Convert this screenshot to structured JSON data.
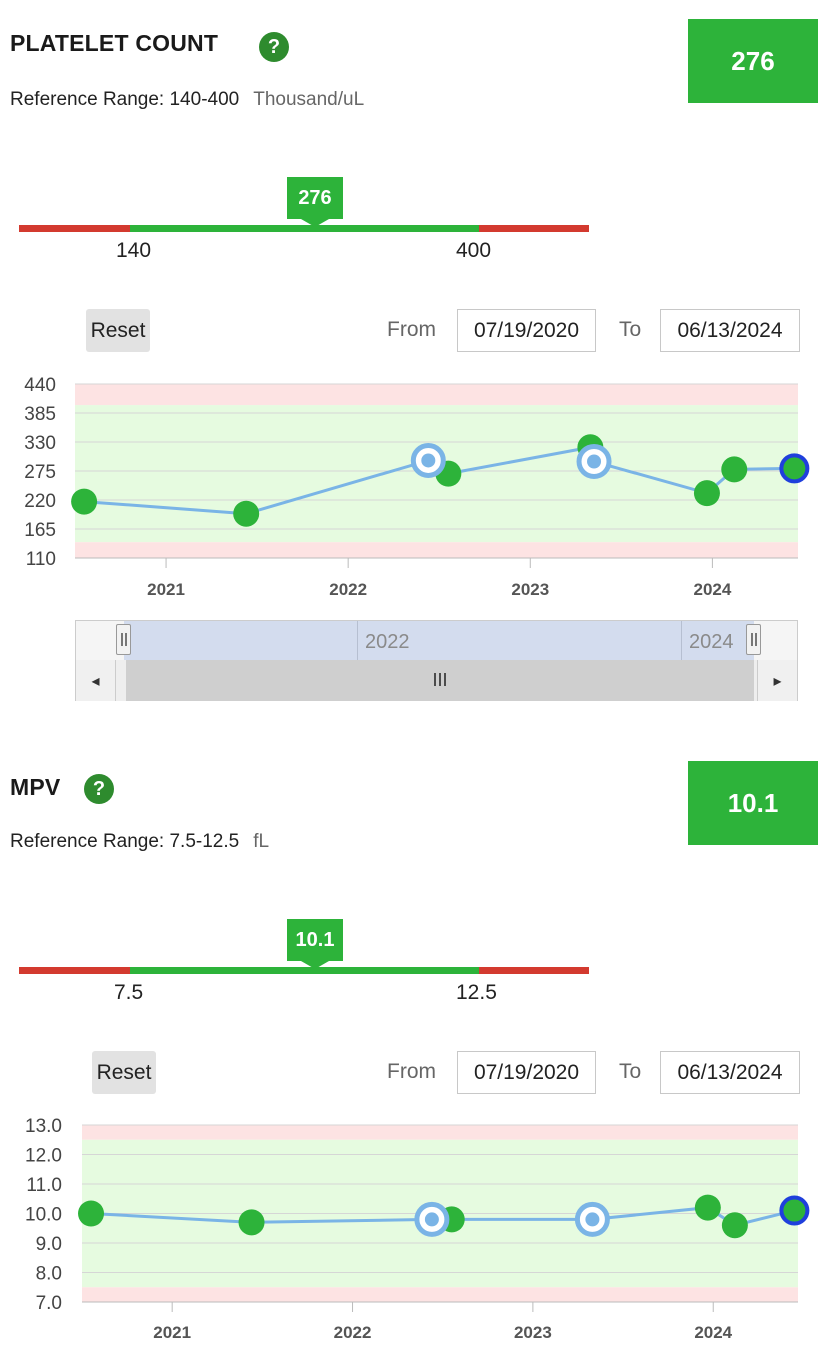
{
  "platelet": {
    "title": "PLATELET COUNT",
    "help": "?",
    "value": "276",
    "ref_label": "Reference Range: 140-400",
    "unit": "Thousand/uL",
    "range_low": "140",
    "range_high": "400",
    "reset": "Reset",
    "from_label": "From",
    "from_value": "07/19/2020",
    "to_label": "To",
    "to_value": "06/13/2024",
    "navigator": {
      "label_2022": "2022",
      "label_2024": "2024",
      "grip": "III",
      "left_arrow": "◂",
      "right_arrow": "▸"
    }
  },
  "mpv": {
    "title": "MPV",
    "help": "?",
    "value": "10.1",
    "ref_label": "Reference Range: 7.5-12.5",
    "unit": "fL",
    "range_low": "7.5",
    "range_high": "12.5",
    "reset": "Reset",
    "from_label": "From",
    "from_value": "07/19/2020",
    "to_label": "To",
    "to_value": "06/13/2024"
  },
  "colors": {
    "accent": "#2db33a",
    "low": "#d33a2f",
    "line": "#7ab4e6",
    "selected": "#1f3fdc",
    "normal_band": "#e6fbe0",
    "abnormal_band": "#fde3e3"
  },
  "chart_data": [
    {
      "type": "line",
      "title": "PLATELET COUNT",
      "x": [
        2020.55,
        2021.44,
        2022.44,
        2022.55,
        2023.33,
        2023.35,
        2023.97,
        2024.12,
        2024.45
      ],
      "y": [
        217,
        194,
        295,
        270,
        320,
        293,
        233,
        278,
        280
      ],
      "highlighted_index": [
        2,
        5
      ],
      "selected_index": 8,
      "ylim": [
        110,
        440
      ],
      "yticks": [
        "440",
        "385",
        "330",
        "275",
        "220",
        "165",
        "110"
      ],
      "xticks": [
        "2021",
        "2022",
        "2023",
        "2024"
      ],
      "normal_range": [
        140,
        400
      ],
      "grid": true
    },
    {
      "type": "line",
      "title": "MPV",
      "x": [
        2020.55,
        2021.44,
        2022.44,
        2022.55,
        2023.33,
        2023.97,
        2024.12,
        2024.45
      ],
      "y": [
        10.0,
        9.7,
        9.8,
        9.8,
        9.8,
        10.2,
        9.6,
        10.1
      ],
      "highlighted_index": [
        2,
        4
      ],
      "selected_index": 7,
      "ylim": [
        7.0,
        13.0
      ],
      "yticks": [
        "13.0",
        "12.0",
        "11.0",
        "10.0",
        "9.0",
        "8.0",
        "7.0"
      ],
      "xticks": [
        "2021",
        "2022",
        "2023",
        "2024"
      ],
      "normal_range": [
        7.5,
        12.5
      ],
      "grid": true
    }
  ]
}
